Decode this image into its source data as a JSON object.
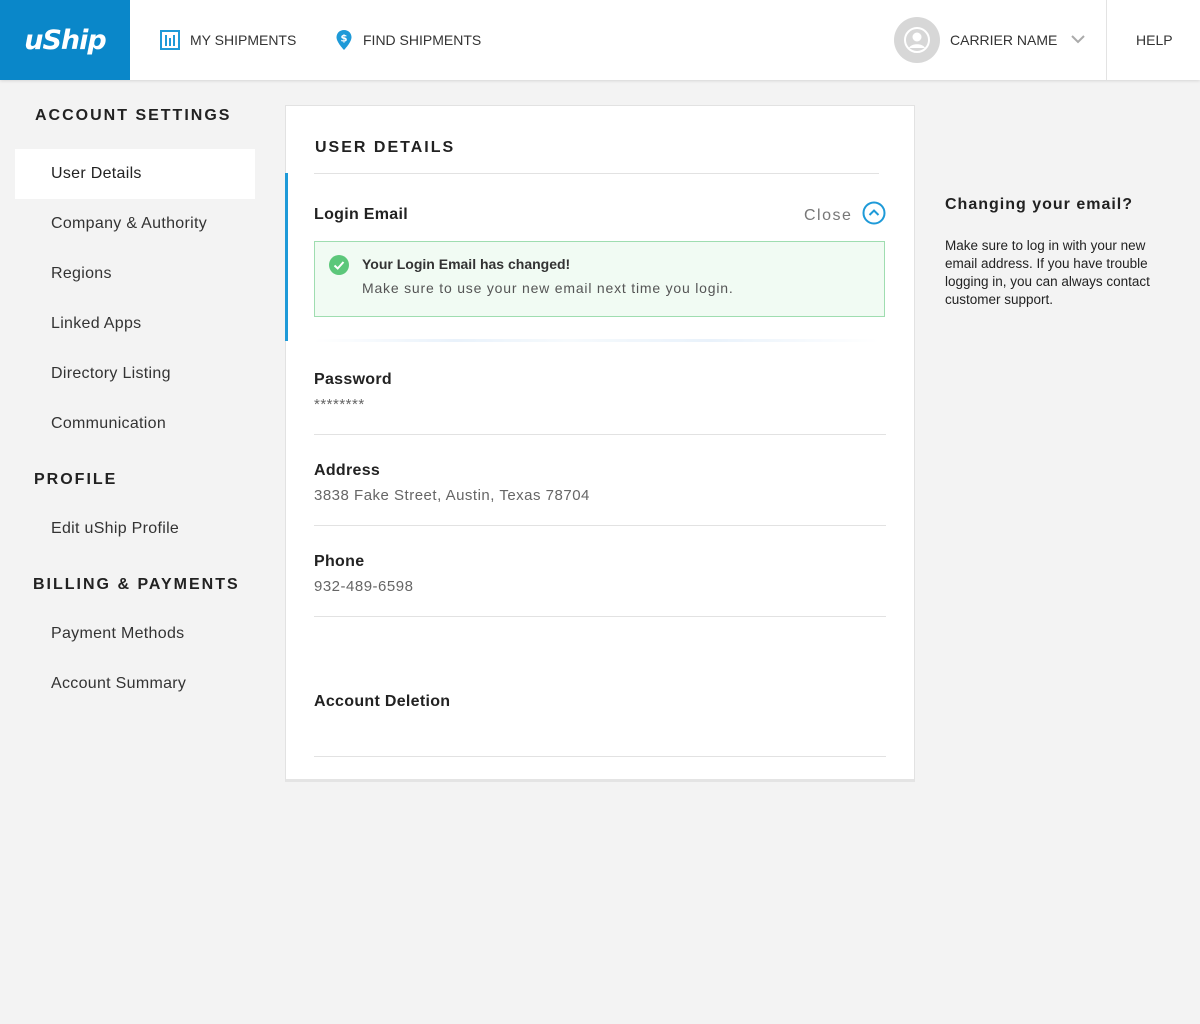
{
  "header": {
    "logo": "uShip",
    "nav": {
      "my_shipments": "MY SHIPMENTS",
      "find_shipments": "FIND SHIPMENTS"
    },
    "user": "CARRIER NAME",
    "help": "HELP"
  },
  "sidebar": {
    "account_settings": {
      "heading": "ACCOUNT SETTINGS",
      "items": [
        "User Details",
        "Company & Authority",
        "Regions",
        "Linked Apps",
        "Directory Listing",
        "Communication"
      ]
    },
    "profile": {
      "heading": "PROFILE",
      "items": [
        "Edit uShip Profile"
      ]
    },
    "billing": {
      "heading": "BILLING & PAYMENTS",
      "items": [
        "Payment Methods",
        "Account Summary"
      ]
    }
  },
  "main": {
    "title": "USER DETAILS",
    "login_email": {
      "label": "Login Email",
      "close": "Close",
      "alert_title": "Your Login Email has changed!",
      "alert_body": "Make sure to use your new email next time you login."
    },
    "password": {
      "label": "Password",
      "value": "********"
    },
    "address": {
      "label": "Address",
      "value": "3838 Fake Street, Austin, Texas 78704"
    },
    "phone": {
      "label": "Phone",
      "value": "932-489-6598"
    },
    "account_deletion": {
      "label": "Account Deletion"
    }
  },
  "help_panel": {
    "title": "Changing your email?",
    "body": "Make sure to log in with your new email address. If you have trouble logging in, you can always contact customer support."
  },
  "colors": {
    "brand": "#0a87c9",
    "accent": "#1e9ad8",
    "success": "#5cc77a"
  }
}
